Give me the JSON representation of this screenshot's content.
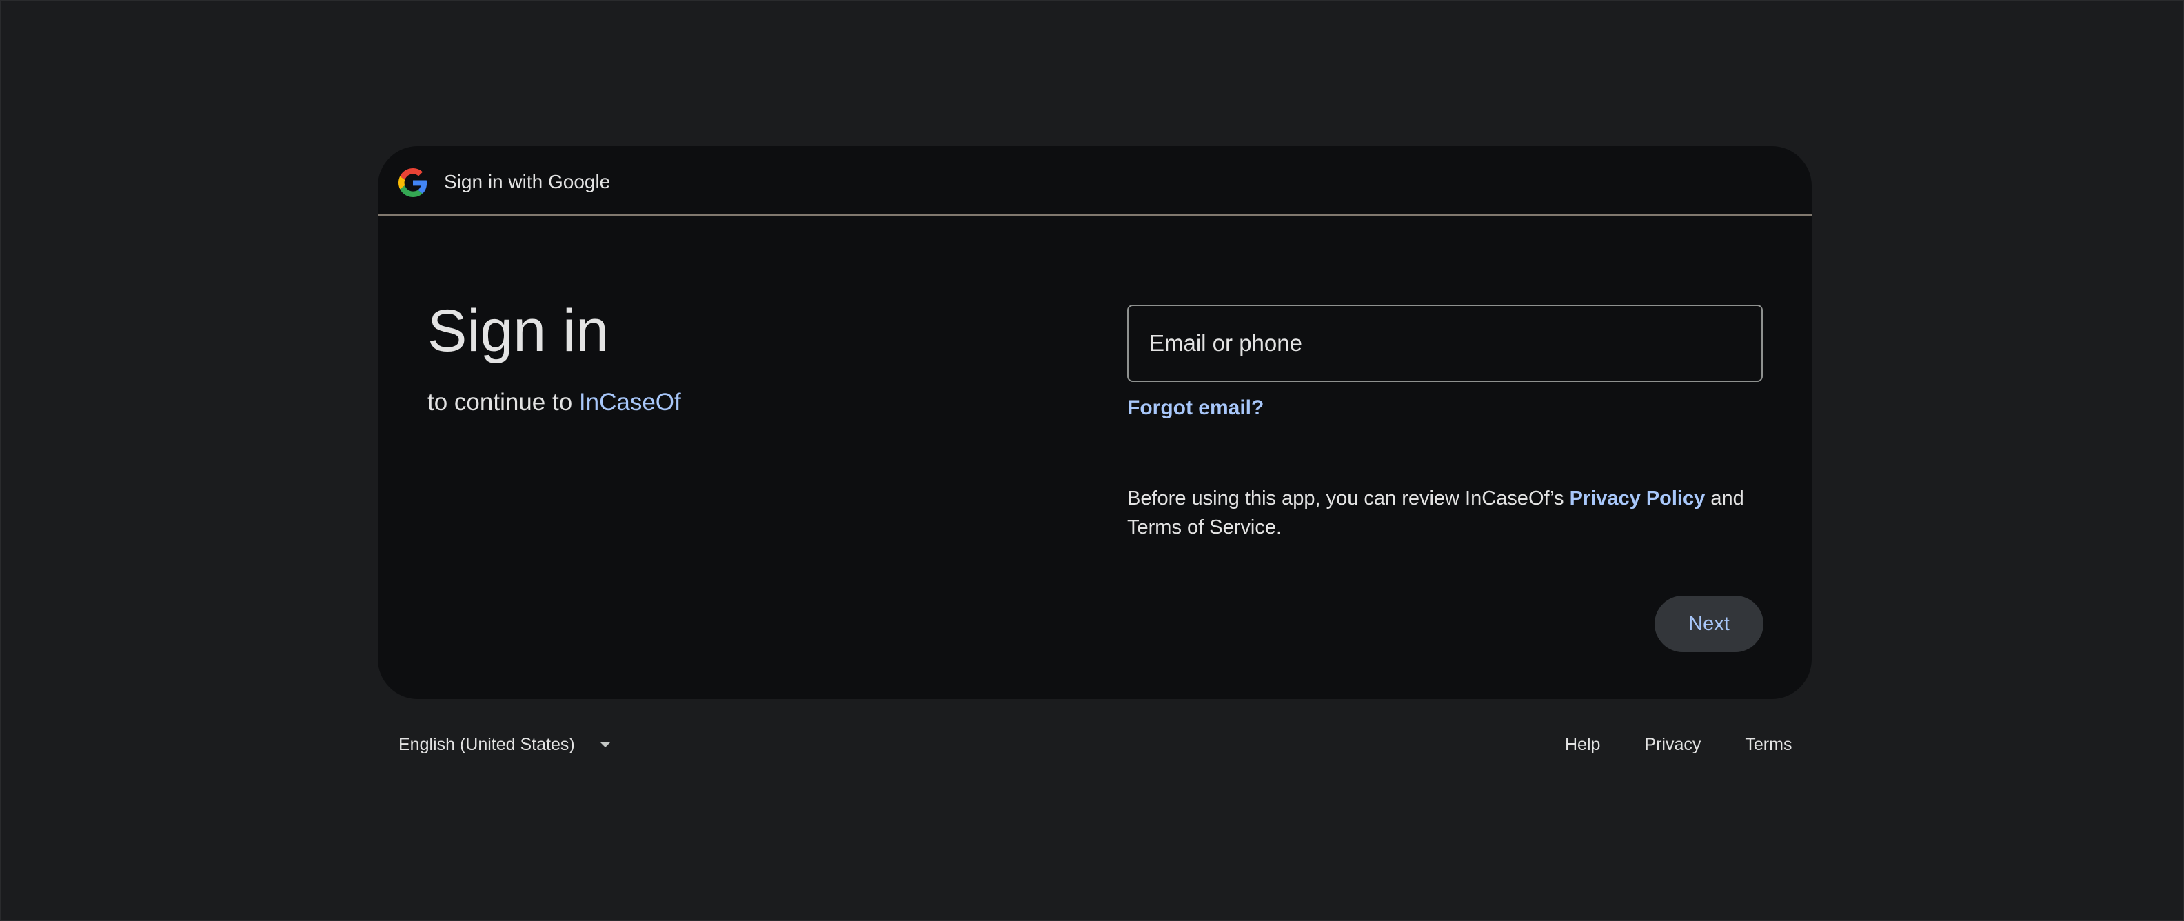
{
  "header": {
    "title": "Sign in with Google",
    "logo_icon": "google-g-icon"
  },
  "main": {
    "heading": "Sign in",
    "subtitle_prefix": "to continue to",
    "app_name": "InCaseOf"
  },
  "form": {
    "email_placeholder": "Email or phone",
    "email_value": "",
    "forgot_email_label": "Forgot email?",
    "notice_prefix": "Before using this app, you can review InCaseOf’s",
    "privacy_policy_label": "Privacy Policy",
    "notice_suffix": "and Terms of Service.",
    "next_label": "Next"
  },
  "footer": {
    "language": "English (United States)",
    "language_icon": "caret-down-icon",
    "links": {
      "help": "Help",
      "privacy": "Privacy",
      "terms": "Terms"
    }
  },
  "colors": {
    "background": "#1b1c1e",
    "card": "#0d0e10",
    "link": "#a8c7fa",
    "text": "#e3e3e3",
    "button": "#33363a",
    "divider": "#80786e"
  }
}
